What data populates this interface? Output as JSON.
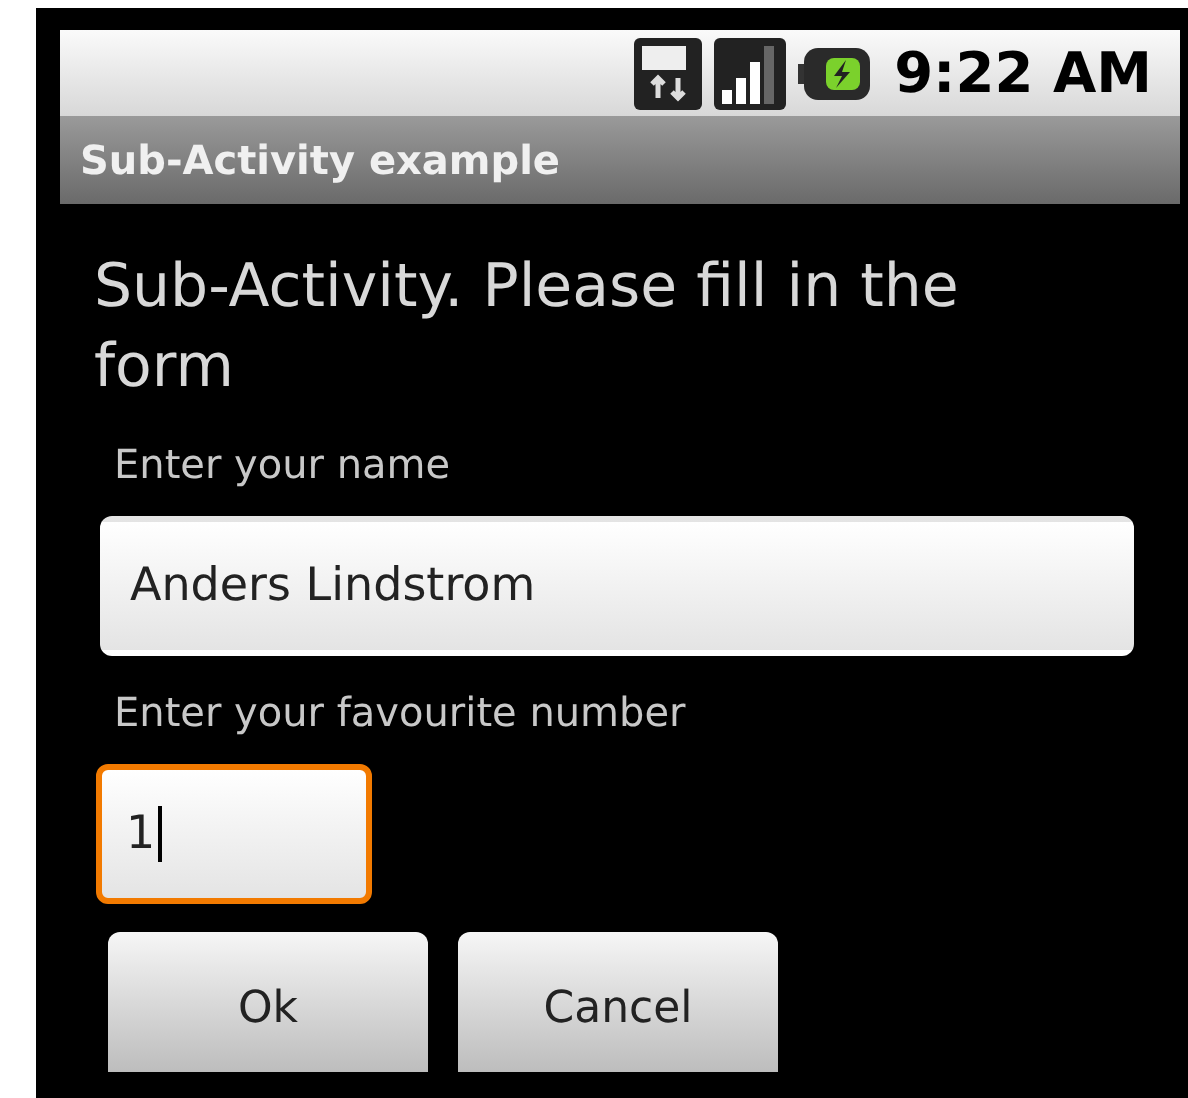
{
  "status_bar": {
    "time": "9:22 AM"
  },
  "title_bar": {
    "title": "Sub-Activity example"
  },
  "heading": "Sub-Activity. Please fill in the form",
  "fields": [
    {
      "label": "Enter your name",
      "value": "Anders Lindstrom",
      "focused": false,
      "kind": "wide"
    },
    {
      "label": "Enter your favourite number",
      "value": "1",
      "focused": true,
      "kind": "narrow"
    }
  ],
  "buttons": [
    "Ok",
    "Cancel"
  ]
}
